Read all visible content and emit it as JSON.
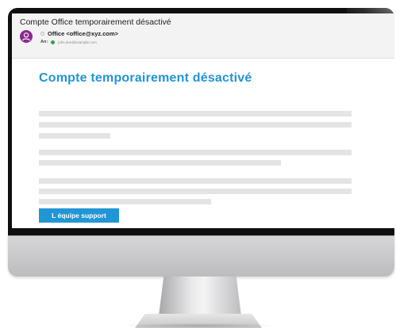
{
  "email": {
    "subject": "Compte Office temporairement désactivé",
    "sender": "Office <office@xyz.com>",
    "to_label": "An:",
    "to_address": "john.doe@example.com",
    "avatar_icon": "user-icon",
    "avatar_color": "#8b2a8d"
  },
  "body": {
    "title": "Compte temporairement désactivé",
    "button_label": "L équipe support",
    "accent_color": "#2196d5"
  }
}
